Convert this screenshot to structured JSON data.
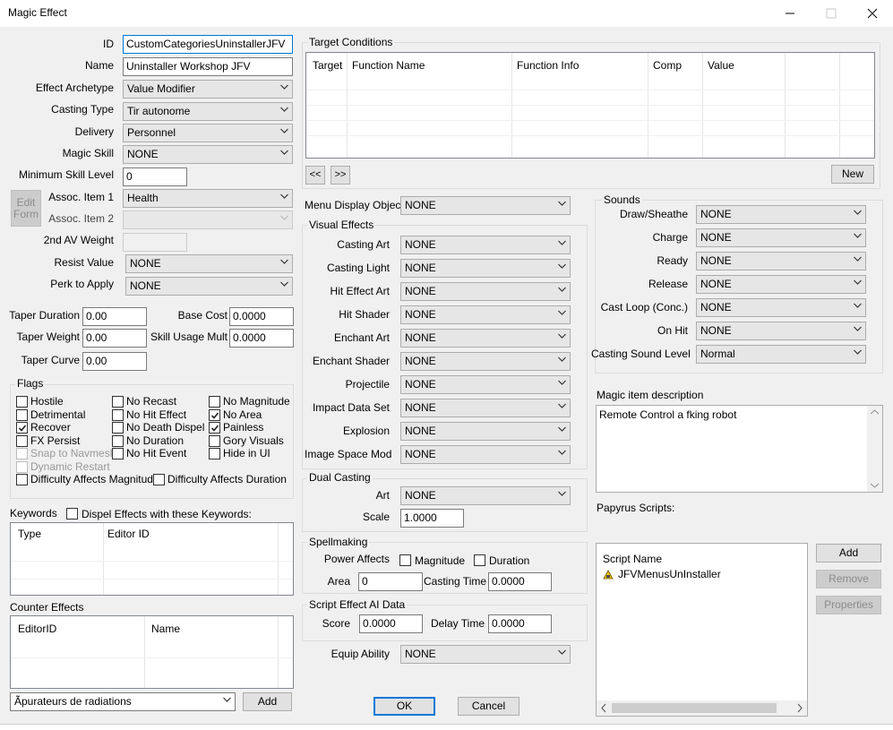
{
  "window": {
    "title": "Magic Effect"
  },
  "form": {
    "id_label": "ID",
    "id_value": "CustomCategoriesUninstallerJFV",
    "name_label": "Name",
    "name_value": "Uninstaller Workshop JFV",
    "archetype_label": "Effect Archetype",
    "archetype_value": "Value Modifier",
    "casting_type_label": "Casting Type",
    "casting_type_value": "Tir autonome",
    "delivery_label": "Delivery",
    "delivery_value": "Personnel",
    "magic_skill_label": "Magic Skill",
    "magic_skill_value": "NONE",
    "min_skill_label": "Minimum Skill Level",
    "min_skill_value": "0",
    "edit_form_label": "Edit\nForm",
    "assoc1_label": "Assoc. Item 1",
    "assoc1_value": "Health",
    "assoc2_label": "Assoc. Item 2",
    "assoc2_value": "",
    "av2_label": "2nd AV Weight",
    "av2_value": "",
    "resist_label": "Resist Value",
    "resist_value": "NONE",
    "perk_label": "Perk to Apply",
    "perk_value": "NONE",
    "taper_duration_label": "Taper Duration",
    "taper_duration_value": "0.00",
    "base_cost_label": "Base Cost",
    "base_cost_value": "0.0000",
    "taper_weight_label": "Taper Weight",
    "taper_weight_value": "0.00",
    "skill_usage_label": "Skill Usage Mult",
    "skill_usage_value": "0.0000",
    "taper_curve_label": "Taper Curve",
    "taper_curve_value": "0.00"
  },
  "flags": {
    "title": "Flags",
    "items": [
      {
        "label": "Hostile",
        "checked": false,
        "disabled": false
      },
      {
        "label": "Detrimental",
        "checked": false,
        "disabled": false
      },
      {
        "label": "Recover",
        "checked": true,
        "disabled": false
      },
      {
        "label": "FX Persist",
        "checked": false,
        "disabled": false
      },
      {
        "label": "Snap to Navmesh",
        "checked": false,
        "disabled": true
      },
      {
        "label": "Dynamic Restart",
        "checked": false,
        "disabled": true
      },
      {
        "label": "No Recast",
        "checked": false,
        "disabled": false
      },
      {
        "label": "No Hit Effect",
        "checked": false,
        "disabled": false
      },
      {
        "label": "No Death Dispel",
        "checked": false,
        "disabled": false
      },
      {
        "label": "No Duration",
        "checked": false,
        "disabled": false
      },
      {
        "label": "No Hit Event",
        "checked": false,
        "disabled": false
      },
      {
        "label": "No Magnitude",
        "checked": false,
        "disabled": false
      },
      {
        "label": "No Area",
        "checked": true,
        "disabled": false
      },
      {
        "label": "Painless",
        "checked": true,
        "disabled": false
      },
      {
        "label": "Gory Visuals",
        "checked": false,
        "disabled": false
      },
      {
        "label": "Hide in UI",
        "checked": false,
        "disabled": false
      },
      {
        "label": "Difficulty Affects Magnitude",
        "checked": false,
        "disabled": false
      },
      {
        "label": "Difficulty Affects Duration",
        "checked": false,
        "disabled": false
      }
    ]
  },
  "keywords": {
    "label": "Keywords",
    "dispel_label": "Dispel Effects with these Keywords:",
    "col_type": "Type",
    "col_editor_id": "Editor ID"
  },
  "counter": {
    "label": "Counter Effects",
    "col_editorid": "EditorID",
    "col_name": "Name",
    "combo_value": "Ãpurateurs de radiations",
    "add_label": "Add"
  },
  "target": {
    "title": "Target Conditions",
    "columns": [
      "Target",
      "Function Name",
      "Function Info",
      "Comp",
      "Value"
    ],
    "prev_label": "<<",
    "next_label": ">>",
    "new_label": "New"
  },
  "menu_display": {
    "label": "Menu Display Object",
    "value": "NONE"
  },
  "visual": {
    "title": "Visual Effects",
    "items": [
      {
        "label": "Casting Art",
        "value": "NONE"
      },
      {
        "label": "Casting Light",
        "value": "NONE"
      },
      {
        "label": "Hit Effect Art",
        "value": "NONE"
      },
      {
        "label": "Hit Shader",
        "value": "NONE"
      },
      {
        "label": "Enchant Art",
        "value": "NONE"
      },
      {
        "label": "Enchant Shader",
        "value": "NONE"
      },
      {
        "label": "Projectile",
        "value": "NONE"
      },
      {
        "label": "Impact Data Set",
        "value": "NONE"
      },
      {
        "label": "Explosion",
        "value": "NONE"
      },
      {
        "label": "Image Space Mod",
        "value": "NONE"
      }
    ]
  },
  "dual": {
    "title": "Dual Casting",
    "art_label": "Art",
    "art_value": "NONE",
    "scale_label": "Scale",
    "scale_value": "1.0000"
  },
  "spell": {
    "title": "Spellmaking",
    "power_label": "Power Affects",
    "magnitude_label": "Magnitude",
    "duration_label": "Duration",
    "area_label": "Area",
    "area_value": "0",
    "casting_time_label": "Casting Time",
    "casting_time_value": "0.0000"
  },
  "ai": {
    "title": "Script Effect AI Data",
    "score_label": "Score",
    "score_value": "0.0000",
    "delay_label": "Delay Time",
    "delay_value": "0.0000"
  },
  "equip": {
    "label": "Equip Ability",
    "value": "NONE"
  },
  "sounds": {
    "title": "Sounds",
    "items": [
      {
        "label": "Draw/Sheathe",
        "value": "NONE"
      },
      {
        "label": "Charge",
        "value": "NONE"
      },
      {
        "label": "Ready",
        "value": "NONE"
      },
      {
        "label": "Release",
        "value": "NONE"
      },
      {
        "label": "Cast Loop (Conc.)",
        "value": "NONE"
      },
      {
        "label": "On Hit",
        "value": "NONE"
      },
      {
        "label": "Casting Sound Level",
        "value": "Normal"
      }
    ]
  },
  "description": {
    "label": "Magic item description",
    "value": "Remote Control a fking robot"
  },
  "scripts": {
    "label": "Papyrus Scripts:",
    "col_name": "Script Name",
    "items": [
      "JFVMenusUnInstaller"
    ],
    "add_label": "Add",
    "remove_label": "Remove",
    "properties_label": "Properties"
  },
  "footer": {
    "ok_label": "OK",
    "cancel_label": "Cancel"
  }
}
